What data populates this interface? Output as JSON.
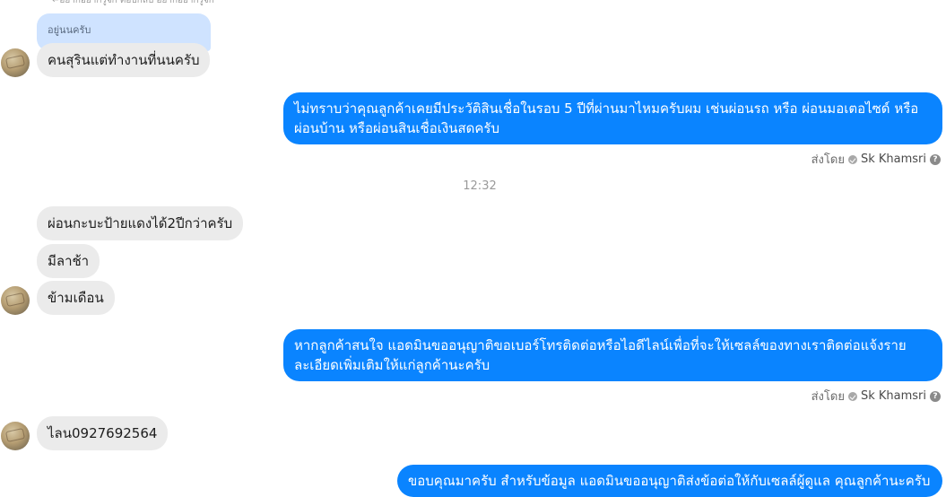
{
  "top_reply_hint": "↩อยากอยากรู้จัก ตอบกลับ อยากอยากรู้จัก",
  "reply_quote": "อยู่นนครับ",
  "messages": {
    "m1": "คนสุรินแต่ทำงานที่นนครับ",
    "m2": "ไม่ทราบว่าคุณลูกค้าเคยมีประวัติสินเชื่อในรอบ 5 ปีที่ผ่านมาไหมครับผม เช่นผ่อนรถ หรือ ผ่อนมอเตอไซด์ หรือ ผ่อนบ้าน หรือผ่อนสินเชื่อเงินสดครับ",
    "time": "12:32",
    "m3": "ผ่อนกะบะป้ายแดงได้2ปีกว่าครับ",
    "m4": "มีลาช้า",
    "m5": "ข้ามเดือน",
    "m6": "หากลูกค้าสนใจ แอดมินขออนุญาติขอเบอร์โทรติดต่อหรือไอดีไลน์เพื่อที่จะให้เซลล์ของทางเราติดต่อแจ้งรายละเอียดเพิ่มเติมให้แก่ลูกค้านะครับ",
    "m7": "ไลน0927692564",
    "m8": "ขอบคุณมาครับ สำหรับข้อมูล แอดมินขออนุญาติส่งข้อต่อให้กับเซลล์ผู้ดูแล คุณลูกค้านะครับ"
  },
  "sent_by": {
    "prefix": "ส่งโดย",
    "name": "Sk Khamsri",
    "help": "?"
  },
  "colors": {
    "outgoing": "#0a84ff",
    "incoming": "#ebebeb"
  }
}
